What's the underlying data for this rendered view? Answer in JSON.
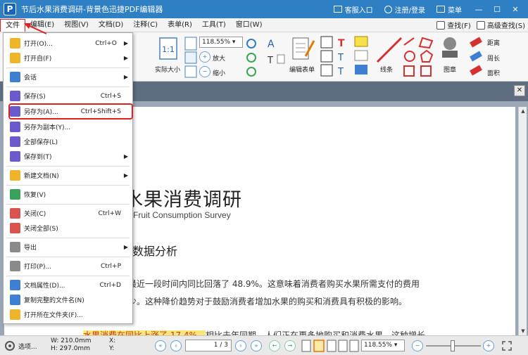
{
  "window": {
    "title": "节后水果消费调研-背景色迅捷PDF编辑器",
    "logo_letter": "P",
    "buttons": {
      "service": "客服入口",
      "login": "注册/登录",
      "menu": "菜单"
    }
  },
  "menubar": {
    "items": [
      "文件",
      "编辑(E)",
      "视图(V)",
      "文档(D)",
      "注释(C)",
      "表单(R)",
      "工具(T)",
      "窗口(W)"
    ],
    "right": {
      "find": "查找(F)",
      "advanced_find": "高级查找(S)"
    }
  },
  "ribbon": {
    "zoom_value": "118.55%",
    "labels": {
      "actual_size": "实际大小",
      "zoom_in": "放大",
      "zoom_out": "缩小",
      "edit_form": "编辑表单",
      "line": "线条",
      "stamp": "图章",
      "distance": "距离",
      "perimeter": "周长",
      "area": "面积"
    }
  },
  "file_menu": {
    "items": [
      {
        "label": "打开(O)...",
        "shortcut": "Ctrl+O",
        "arrow": "▶"
      },
      {
        "label": "打开自(F)",
        "shortcut": "",
        "arrow": "▶"
      },
      {
        "label": "会话",
        "shortcut": "",
        "arrow": "▶"
      },
      {
        "label": "保存(S)",
        "shortcut": "Ctrl+S",
        "arrow": ""
      },
      {
        "label": "另存为(A)...",
        "shortcut": "Ctrl+Shift+S",
        "arrow": ""
      },
      {
        "label": "另存为副本(Y)...",
        "shortcut": "",
        "arrow": ""
      },
      {
        "label": "全部保存(L)",
        "shortcut": "",
        "arrow": ""
      },
      {
        "label": "保存到(T)",
        "shortcut": "",
        "arrow": "▶"
      },
      {
        "label": "新建文档(N)",
        "shortcut": "",
        "arrow": "▶"
      },
      {
        "label": "恢复(V)",
        "shortcut": "",
        "arrow": ""
      },
      {
        "label": "关闭(C)",
        "shortcut": "Ctrl+W",
        "arrow": ""
      },
      {
        "label": "关闭全部(S)",
        "shortcut": "",
        "arrow": ""
      },
      {
        "label": "导出",
        "shortcut": "",
        "arrow": "▶"
      },
      {
        "label": "打印(P)...",
        "shortcut": "Ctrl+P",
        "arrow": ""
      },
      {
        "label": "文档属性(D)...",
        "shortcut": "Ctrl+D",
        "arrow": ""
      },
      {
        "label": "复制完整的文件名(N)",
        "shortcut": "",
        "arrow": ""
      },
      {
        "label": "打开所在文件夹(F)...",
        "shortcut": "",
        "arrow": ""
      }
    ]
  },
  "document": {
    "title": "水果消费调研",
    "subtitle": "Fruit Consumption Survey",
    "heading": "数据分析",
    "para1_line1": "最近一段时间内同比回落了  48.9%。这意味着消费者购买水果所需支付的费用",
    "para1_line2": "少。这种降价趋势对于鼓励消费者增加水果的购买和消费具有积极的影响。",
    "para2_highlight": "水果消费在同比上涨了 17.4%。",
    "para2_rest": "相比去年同期，人们正在更多地购买和消费水果。这种增长"
  },
  "statusbar": {
    "options": "选项...",
    "width": "W: 210.0mm",
    "height": "H: 297.0mm",
    "x": "X:",
    "y": "Y:",
    "page": "1 / 3",
    "zoom": "118.55%"
  }
}
